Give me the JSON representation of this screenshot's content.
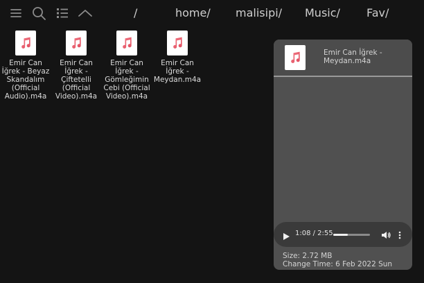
{
  "toolbar": {
    "icons": [
      "menu-icon",
      "search-icon",
      "list-view-icon",
      "chevron-up-icon"
    ],
    "breadcrumbs": [
      "/",
      "home/",
      "malisipi/",
      "Music/",
      "Fav/"
    ]
  },
  "files": [
    {
      "name": "Emir Can İğrek - Beyaz Skandalım (Official Audio).m4a",
      "icon": "music-note-icon"
    },
    {
      "name": "Emir Can İğrek - Çiftetelli (Official Video).m4a",
      "icon": "music-note-icon"
    },
    {
      "name": "Emir Can İğrek - Gömleğimin Cebi (Official Video).m4a",
      "icon": "music-note-icon"
    },
    {
      "name": "Emir Can İğrek - Meydan.m4a",
      "icon": "music-note-icon"
    }
  ],
  "preview": {
    "title": "Emir Can İğrek - Meydan.m4a",
    "player": {
      "time": "1:08 / 2:55",
      "progress": 0.39
    },
    "size": "Size: 2.72 MB",
    "change_time": "Change Time: 6 Feb 2022 Sun"
  },
  "colors": {
    "background": "#141414",
    "panel": "#505050",
    "note_accent": "#e8606e"
  }
}
